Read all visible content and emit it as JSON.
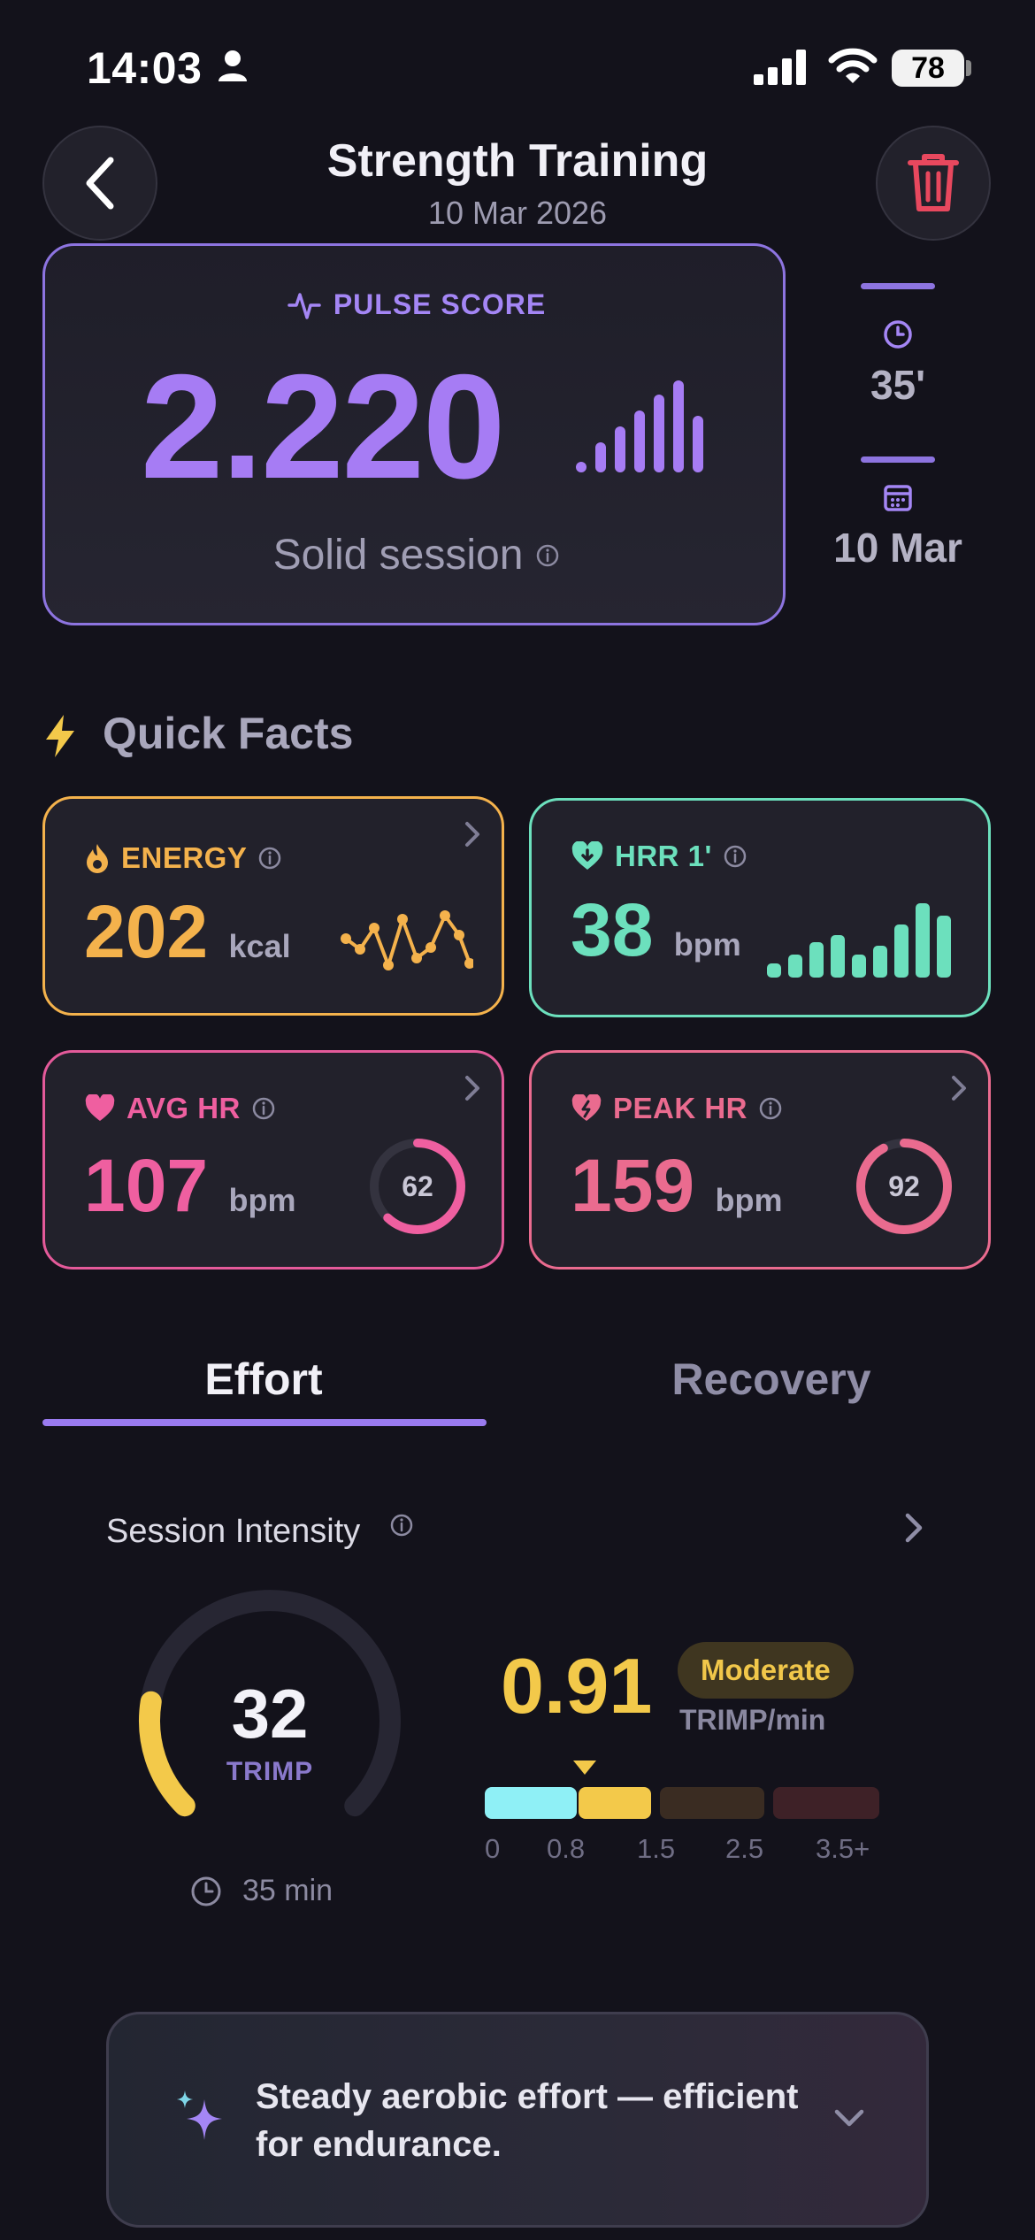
{
  "status_bar": {
    "time": "14:03",
    "battery": "78"
  },
  "header": {
    "title": "Strength Training",
    "date": "10 Mar 2026"
  },
  "pulse_score": {
    "label": "PULSE SCORE",
    "value": "2.220",
    "verdict": "Solid session"
  },
  "side_stats": {
    "duration": "35'",
    "date": "10 Mar"
  },
  "quick_facts": {
    "title": "Quick Facts",
    "energy": {
      "label": "ENERGY",
      "value": "202",
      "unit": "kcal",
      "color": "#f4b24c"
    },
    "hrr": {
      "label": "HRR 1'",
      "value": "38",
      "unit": "bpm",
      "color": "#6ce0bd"
    },
    "avg_hr": {
      "label": "AVG HR",
      "value": "107",
      "unit": "bpm",
      "ring_value": "62",
      "ring_fraction": 0.62,
      "color": "#e45a9a"
    },
    "peak_hr": {
      "label": "PEAK HR",
      "value": "159",
      "unit": "bpm",
      "ring_value": "92",
      "ring_fraction": 0.92,
      "color": "#ea6b8f"
    }
  },
  "tabs": {
    "effort": "Effort",
    "recovery": "Recovery",
    "active": "Effort"
  },
  "session_intensity": {
    "title": "Session Intensity",
    "trimp": "32",
    "trimp_unit": "TRIMP",
    "gauge_fraction": 0.2,
    "duration": "35 min",
    "rate": "0.91",
    "rate_unit": "TRIMP/min",
    "zone": "Moderate",
    "scale_ticks": [
      "0",
      "0.8",
      "1.5",
      "2.5",
      "3.5+"
    ]
  },
  "insight": {
    "text": "Steady aerobic effort — efficient for endurance."
  },
  "icons": [
    "person-icon",
    "signal-icon",
    "wifi-icon",
    "back-icon",
    "trash-icon",
    "pulse-icon",
    "bars-icon",
    "info-icon",
    "clock-icon",
    "calendar-icon",
    "bolt-icon",
    "flame-icon",
    "heart-down-icon",
    "heart-icon",
    "heart-pulse-icon",
    "chevron-right-icon",
    "sparkle-icon",
    "chevron-down-icon"
  ]
}
